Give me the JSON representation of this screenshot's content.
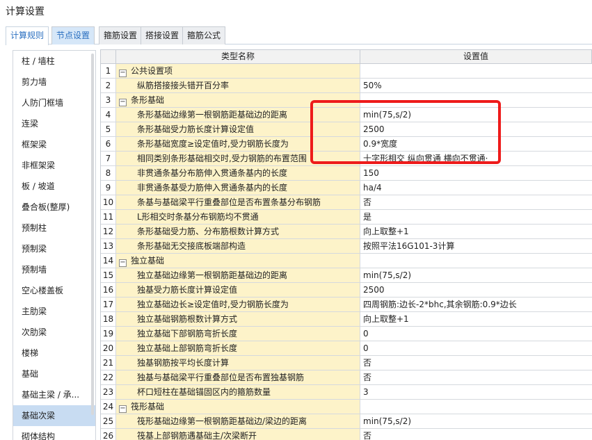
{
  "window": {
    "title": "计算设置"
  },
  "tabs": [
    {
      "label": "计算规则",
      "active": true
    },
    {
      "label": "节点设置",
      "blue": true
    },
    {
      "label": "箍筋设置"
    },
    {
      "label": "搭接设置"
    },
    {
      "label": "箍筋公式"
    }
  ],
  "sidebar": {
    "active_index": 17,
    "items": [
      "柱 / 墙柱",
      "剪力墙",
      "人防门框墙",
      "连梁",
      "框架梁",
      "非框架梁",
      "板 / 坡道",
      "叠合板(整厚)",
      "预制柱",
      "预制梁",
      "预制墙",
      "空心楼盖板",
      "主肋梁",
      "次肋梁",
      "楼梯",
      "基础",
      "基础主梁 / 承...",
      "基础次梁",
      "砌体结构"
    ]
  },
  "table": {
    "headers": {
      "name": "类型名称",
      "value": "设置值"
    },
    "rows": [
      {
        "num": "1",
        "group": true,
        "name": "公共设置项",
        "value": ""
      },
      {
        "num": "2",
        "name": "纵筋搭接接头错开百分率",
        "value": "50%"
      },
      {
        "num": "3",
        "group": true,
        "name": "条形基础",
        "value": ""
      },
      {
        "num": "4",
        "name": "条形基础边缘第一根钢筋距基础边的距离",
        "value": "min(75,s/2)"
      },
      {
        "num": "5",
        "name": "条形基础受力筋长度计算设定值",
        "value": "2500"
      },
      {
        "num": "6",
        "name": "条形基础宽度≥设定值时,受力钢筋长度为",
        "value": "0.9*宽度"
      },
      {
        "num": "7",
        "name": "相同类别条形基础相交时,受力钢筋的布置范围",
        "value": "十字形相交 纵向贯通 横向不贯通·"
      },
      {
        "num": "8",
        "name": "非贯通条基分布筋伸入贯通条基内的长度",
        "value": "150"
      },
      {
        "num": "9",
        "name": "非贯通条基受力筋伸入贯通条基内的长度",
        "value": "ha/4"
      },
      {
        "num": "10",
        "name": "条基与基础梁平行重叠部位是否布置条基分布钢筋",
        "value": "否"
      },
      {
        "num": "11",
        "name": "L形相交时条基分布钢筋均不贯通",
        "value": "是"
      },
      {
        "num": "12",
        "name": "条形基础受力筋、分布筋根数计算方式",
        "value": "向上取整+1"
      },
      {
        "num": "13",
        "name": "条形基础无交接底板端部构造",
        "value": "按照平法16G101-3计算"
      },
      {
        "num": "14",
        "group": true,
        "name": "独立基础",
        "value": ""
      },
      {
        "num": "15",
        "name": "独立基础边缘第一根钢筋距基础边的距离",
        "value": "min(75,s/2)"
      },
      {
        "num": "16",
        "name": "独基受力筋长度计算设定值",
        "value": "2500"
      },
      {
        "num": "17",
        "name": "独立基础边长≥设定值时,受力钢筋长度为",
        "value": "四周钢筋:边长-2*bhc,其余钢筋:0.9*边长"
      },
      {
        "num": "18",
        "name": "独立基础钢筋根数计算方式",
        "value": "向上取整+1"
      },
      {
        "num": "19",
        "name": "独立基础下部钢筋弯折长度",
        "value": "0"
      },
      {
        "num": "20",
        "name": "独立基础上部钢筋弯折长度",
        "value": "0"
      },
      {
        "num": "21",
        "name": "独基钢筋按平均长度计算",
        "value": "否"
      },
      {
        "num": "22",
        "name": "独基与基础梁平行重叠部位是否布置独基钢筋",
        "value": "否"
      },
      {
        "num": "23",
        "name": "杯口短柱在基础锚固区内的箍筋数量",
        "value": "3"
      },
      {
        "num": "24",
        "group": true,
        "name": "筏形基础",
        "value": ""
      },
      {
        "num": "25",
        "name": "筏形基础边缘第一根钢筋距基础边/梁边的距离",
        "value": "min(75,s/2)"
      },
      {
        "num": "26",
        "name": "筏基上部钢筋遇基础主/次梁断开",
        "value": "否"
      }
    ]
  },
  "colors": {
    "highlight_border": "#ee1b1b",
    "name_cell_bg": "#fdf3c9",
    "active_tab_text": "#2a6fc0"
  },
  "icons": {
    "collapse": "minus-box-icon"
  }
}
